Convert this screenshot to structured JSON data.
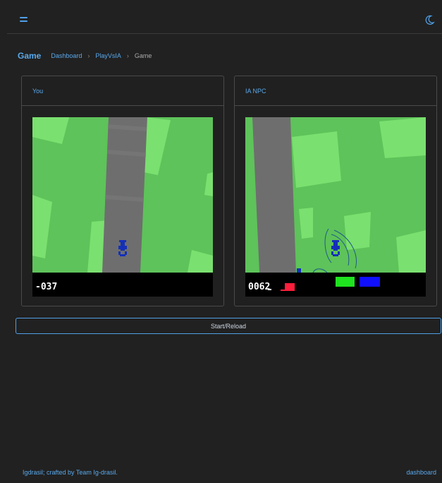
{
  "breadcrumb": {
    "title": "Game",
    "items": [
      "Dashboard",
      "PlayVsIA",
      "Game"
    ],
    "separator": "›"
  },
  "panels": {
    "player": {
      "title": "You",
      "score": "-037"
    },
    "npc": {
      "title": "IA NPC",
      "score": "0062"
    }
  },
  "start_button": {
    "label": "Start/Reload"
  },
  "footer": {
    "brand_text": "Igdrasil; crafted by Team ",
    "team_link": "Ig-drasil",
    "trailing": ".",
    "right_link": "dashboard"
  },
  "colors": {
    "accent": "#5aa9ec",
    "grass_dark": "#5ec35a",
    "grass_light": "#7ae06f",
    "road": "#6e6e6e",
    "car": "#1530b8"
  },
  "icons": {
    "menu": "hamburger-menu-icon",
    "theme": "moon-icon"
  }
}
